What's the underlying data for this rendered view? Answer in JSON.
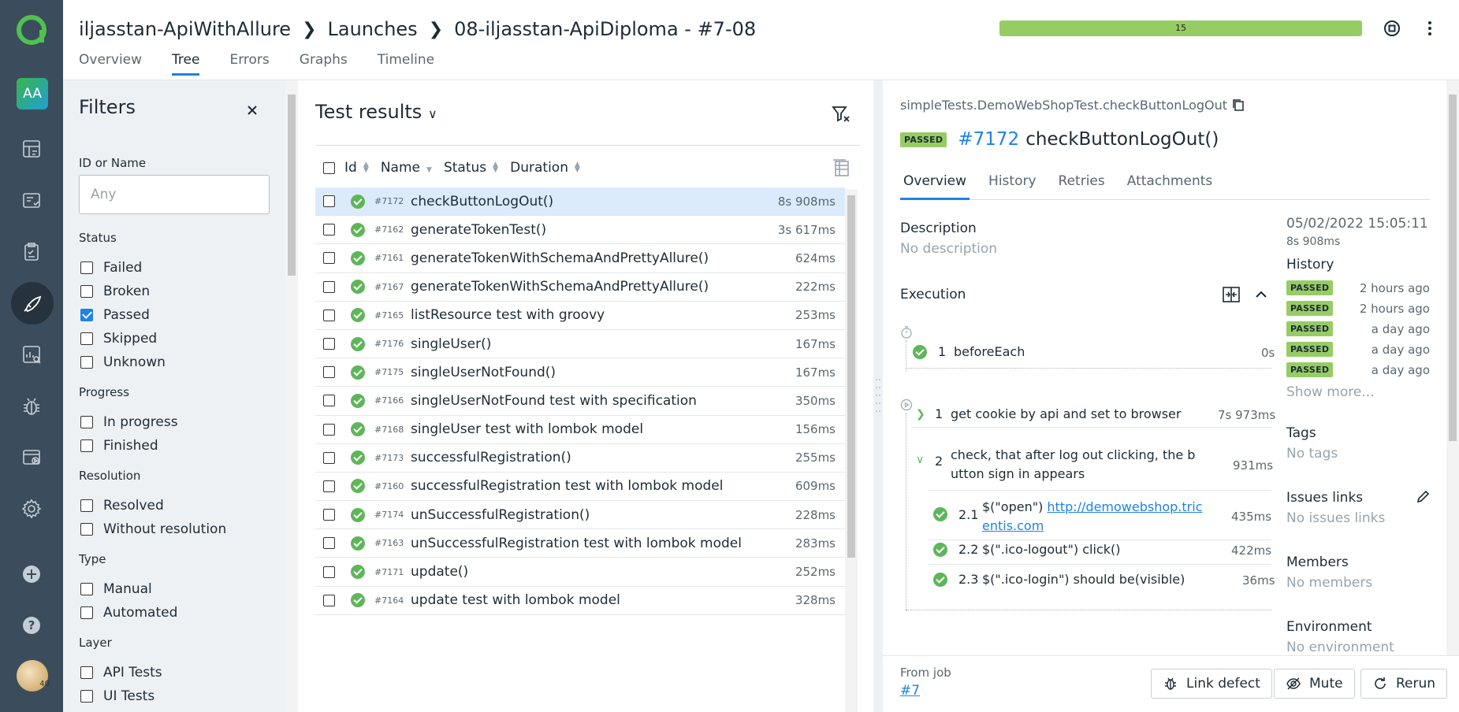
{
  "header": {
    "breadcrumb": [
      "iljasstan-ApiWithAllure",
      "Launches",
      "08-iljasstan-ApiDiploma - #7-08"
    ],
    "progress_label": "15",
    "progress_fraction": 1.0,
    "tabs": [
      "Overview",
      "Tree",
      "Errors",
      "Graphs",
      "Timeline"
    ],
    "active_tab": "Tree"
  },
  "rail": {
    "project_initials": "AA",
    "avatar_badge": "40",
    "icons": [
      "dashboard-icon",
      "test-cases-icon",
      "test-plans-icon",
      "launches-icon",
      "analytics-icon",
      "defects-icon",
      "jobs-icon",
      "settings-icon",
      "add-icon",
      "help-icon"
    ]
  },
  "filters": {
    "title": "Filters",
    "id_label": "ID or Name",
    "id_placeholder": "Any",
    "status_label": "Status",
    "status": [
      {
        "label": "Failed",
        "checked": false
      },
      {
        "label": "Broken",
        "checked": false
      },
      {
        "label": "Passed",
        "checked": true
      },
      {
        "label": "Skipped",
        "checked": false
      },
      {
        "label": "Unknown",
        "checked": false
      }
    ],
    "progress_label": "Progress",
    "progress": [
      "In progress",
      "Finished"
    ],
    "resolution_label": "Resolution",
    "resolution": [
      "Resolved",
      "Without resolution"
    ],
    "type_label": "Type",
    "type": [
      "Manual",
      "Automated"
    ],
    "layer_label": "Layer",
    "layer": [
      "API Tests",
      "UI Tests"
    ]
  },
  "results": {
    "title": "Test results",
    "columns": [
      "Id",
      "Name",
      "Status",
      "Duration"
    ],
    "rows": [
      {
        "id": "#7172",
        "name": "checkButtonLogOut()",
        "duration": "8s 908ms",
        "selected": true
      },
      {
        "id": "#7162",
        "name": "generateTokenTest()",
        "duration": "3s 617ms"
      },
      {
        "id": "#7161",
        "name": "generateTokenWithSchemaAndPrettyAllure()",
        "duration": "624ms"
      },
      {
        "id": "#7167",
        "name": "generateTokenWithSchemaAndPrettyAllure()",
        "duration": "222ms"
      },
      {
        "id": "#7165",
        "name": "listResource test with groovy",
        "duration": "253ms"
      },
      {
        "id": "#7176",
        "name": "singleUser()",
        "duration": "167ms"
      },
      {
        "id": "#7175",
        "name": "singleUserNotFound()",
        "duration": "167ms"
      },
      {
        "id": "#7166",
        "name": "singleUserNotFound test with specification",
        "duration": "350ms"
      },
      {
        "id": "#7168",
        "name": "singleUser test with lombok model",
        "duration": "156ms"
      },
      {
        "id": "#7173",
        "name": "successfulRegistration()",
        "duration": "255ms"
      },
      {
        "id": "#7160",
        "name": "successfulRegistration test with lombok model",
        "duration": "609ms"
      },
      {
        "id": "#7174",
        "name": "unSuccessfulRegistration()",
        "duration": "228ms"
      },
      {
        "id": "#7163",
        "name": "unSuccessfulRegistration test with lombok model",
        "duration": "283ms"
      },
      {
        "id": "#7171",
        "name": "update()",
        "duration": "252ms"
      },
      {
        "id": "#7164",
        "name": "update test with lombok model",
        "duration": "328ms"
      }
    ]
  },
  "details": {
    "path": "simpleTests.DemoWebShopTest.checkButtonLogOut",
    "status_badge": "PASSED",
    "number": "#7172",
    "name": "checkButtonLogOut()",
    "tabs": [
      "Overview",
      "History",
      "Retries",
      "Attachments"
    ],
    "description_title": "Description",
    "description": "No description",
    "execution_title": "Execution",
    "before_step": {
      "index": "1",
      "name": "beforeEach",
      "duration": "0s"
    },
    "step1": {
      "index": "1",
      "name": "get cookie by api and set to browser",
      "duration": "7s 973ms"
    },
    "step2": {
      "index": "2",
      "name_line1": "check, that after log out clicking, the b",
      "name_line2": "utton sign in appears",
      "duration": "931ms"
    },
    "substeps": [
      {
        "index": "2.1",
        "prefix": "$(\"open\") ",
        "link_line1": "http://demowebshop.tric",
        "link_line2": "entis.com",
        "duration": "435ms"
      },
      {
        "index": "2.2",
        "text": "$(\".ico-logout\") click()",
        "duration": "422ms"
      },
      {
        "index": "2.3",
        "text": "$(\".ico-login\") should be(visible)",
        "duration": "36ms"
      }
    ],
    "datetime": "05/02/2022 15:05:11",
    "duration": "8s 908ms",
    "history_title": "History",
    "history": [
      {
        "status": "PASSED",
        "when": "2 hours ago"
      },
      {
        "status": "PASSED",
        "when": "2 hours ago"
      },
      {
        "status": "PASSED",
        "when": "a day ago"
      },
      {
        "status": "PASSED",
        "when": "a day ago"
      },
      {
        "status": "PASSED",
        "when": "a day ago"
      }
    ],
    "show_more": "Show more...",
    "tags_title": "Tags",
    "tags": "No tags",
    "issues_title": "Issues links",
    "issues": "No issues links",
    "members_title": "Members",
    "members": "No members",
    "environment_title": "Environment",
    "environment": "No environment"
  },
  "footer": {
    "from_job_label": "From job",
    "job": "#7",
    "link_defect": "Link defect",
    "mute": "Mute",
    "rerun": "Rerun"
  },
  "colors": {
    "rail": "#3b4c5c",
    "accent": "#1f82e6",
    "passed": "#97cc64",
    "ok_icon": "#5fb65a",
    "selected_row": "#dcebfb"
  }
}
